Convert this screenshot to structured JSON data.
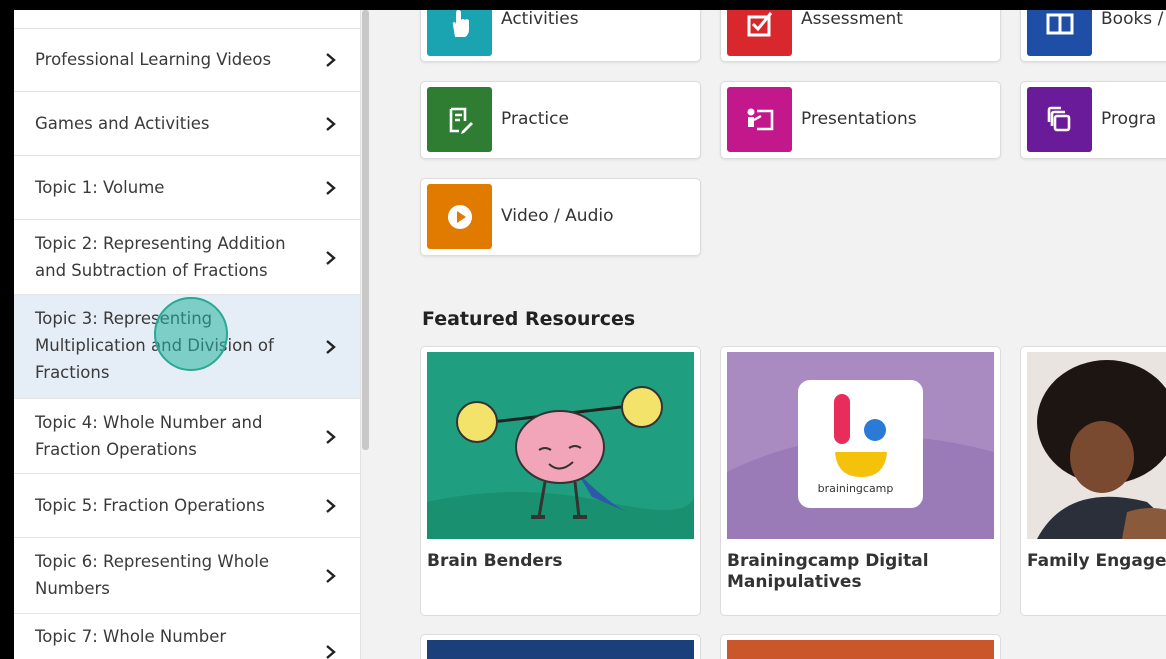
{
  "sidebar": {
    "items": [
      {
        "label": "Professional Learning Videos"
      },
      {
        "label": "Games and Activities"
      },
      {
        "label": "Topic 1: Volume"
      },
      {
        "label": "Topic 2: Representing Addition and Subtraction of Fractions"
      },
      {
        "label": "Topic 3: Representing Multiplication and Division of Fractions",
        "active": true
      },
      {
        "label": "Topic 4: Whole Number and Fraction Operations"
      },
      {
        "label": "Topic 5: Fraction Operations"
      },
      {
        "label": "Topic 6: Representing Whole Numbers"
      },
      {
        "label": "Topic 7: Whole Number"
      }
    ]
  },
  "resource_types": [
    {
      "label": "Activities",
      "icon": "hand-pointer-icon",
      "color": "#1aa3b0"
    },
    {
      "label": "Assessment",
      "icon": "checkbox-icon",
      "color": "#d9272e"
    },
    {
      "label": "Books /",
      "icon": "book-icon",
      "color": "#1e4ea6"
    },
    {
      "label": "Practice",
      "icon": "pencil-doc-icon",
      "color": "#2e7d32"
    },
    {
      "label": "Presentations",
      "icon": "presenter-icon",
      "color": "#c2188c"
    },
    {
      "label": "Progra",
      "icon": "layers-icon",
      "color": "#6a1b9a"
    },
    {
      "label": "Video / Audio",
      "icon": "play-icon",
      "color": "#e07b00"
    }
  ],
  "featured": {
    "title": "Featured Resources",
    "cards": [
      {
        "label": "Brain Benders",
        "image": "brain-lifting-image"
      },
      {
        "label": "Brainingcamp Digital Manipulatives",
        "image": "brainingcamp-logo-image",
        "logo_text": "brainingcamp"
      },
      {
        "label": "Family Engagen",
        "image": "family-photo-image"
      }
    ]
  }
}
